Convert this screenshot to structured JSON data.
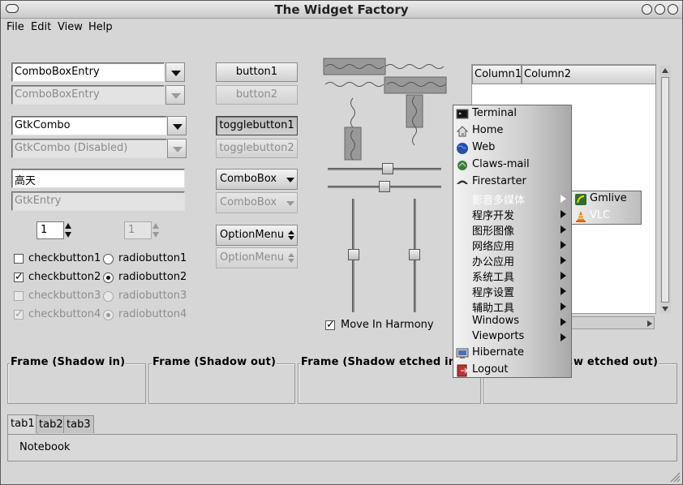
{
  "window": {
    "title": "The Widget Factory"
  },
  "menubar": {
    "items": [
      {
        "label": "File"
      },
      {
        "label": "Edit"
      },
      {
        "label": "View"
      },
      {
        "label": "Help"
      }
    ]
  },
  "col1": {
    "combo_entry_1": "ComboBoxEntry",
    "combo_entry_2": "ComboBoxEntry",
    "gtkcombo_1": "GtkCombo",
    "gtkcombo_2": "GtkCombo (Disabled)",
    "entry_1": "高天",
    "entry_2": "GtkEntry",
    "spin_1": "1",
    "spin_2": "1",
    "check1": "checkbutton1",
    "check2": "checkbutton2",
    "check3": "checkbutton3",
    "check4": "checkbutton4",
    "radio1": "radiobutton1",
    "radio2": "radiobutton2",
    "radio3": "radiobutton3",
    "radio4": "radiobutton4"
  },
  "col2": {
    "button1": "button1",
    "button2": "button2",
    "toggle1": "togglebutton1",
    "toggle2": "togglebutton2",
    "combobox1": "ComboBox",
    "combobox2": "ComboBox",
    "optionmenu1": "OptionMenu",
    "optionmenu2": "OptionMenu"
  },
  "scales": {
    "harmony_label": "Move In Harmony"
  },
  "tree": {
    "columns": [
      "Column1",
      "Column2"
    ]
  },
  "frames": [
    {
      "label": "Frame (Shadow in)"
    },
    {
      "label": "Frame (Shadow out)"
    },
    {
      "label": "Frame (Shadow etched in)"
    },
    {
      "label": "w etched out)"
    }
  ],
  "notebook": {
    "tabs": [
      "tab1",
      "tab2",
      "tab3"
    ],
    "page_label": "Notebook"
  },
  "popup_menu": {
    "items": [
      {
        "label": "Terminal",
        "icon": "terminal-icon"
      },
      {
        "label": "Home",
        "icon": "home-icon"
      },
      {
        "label": "Web",
        "icon": "globe-icon"
      },
      {
        "label": "Claws-mail",
        "icon": "mail-icon"
      },
      {
        "label": "Firestarter",
        "icon": "firewall-icon"
      },
      {
        "label": "影音多媒体",
        "submenu": true,
        "selected": true
      },
      {
        "label": "程序开发",
        "submenu": true
      },
      {
        "label": "图形图像",
        "submenu": true
      },
      {
        "label": "网络应用",
        "submenu": true
      },
      {
        "label": "办公应用",
        "submenu": true
      },
      {
        "label": "系统工具",
        "submenu": true
      },
      {
        "label": "程序设置",
        "submenu": true
      },
      {
        "label": "辅助工具",
        "submenu": true
      },
      {
        "label": "Windows",
        "submenu": true
      },
      {
        "label": "Viewports",
        "submenu": true
      },
      {
        "label": "Hibernate",
        "icon": "hibernate-icon"
      },
      {
        "label": "Logout",
        "icon": "logout-icon"
      }
    ]
  },
  "submenu": {
    "items": [
      {
        "label": "Gmlive",
        "icon": "gmlive-icon"
      },
      {
        "label": "VLC",
        "icon": "vlc-icon"
      }
    ]
  },
  "colors": {
    "menu_selected_text": "#ffffff",
    "window_bg": "#d6d6d6"
  }
}
